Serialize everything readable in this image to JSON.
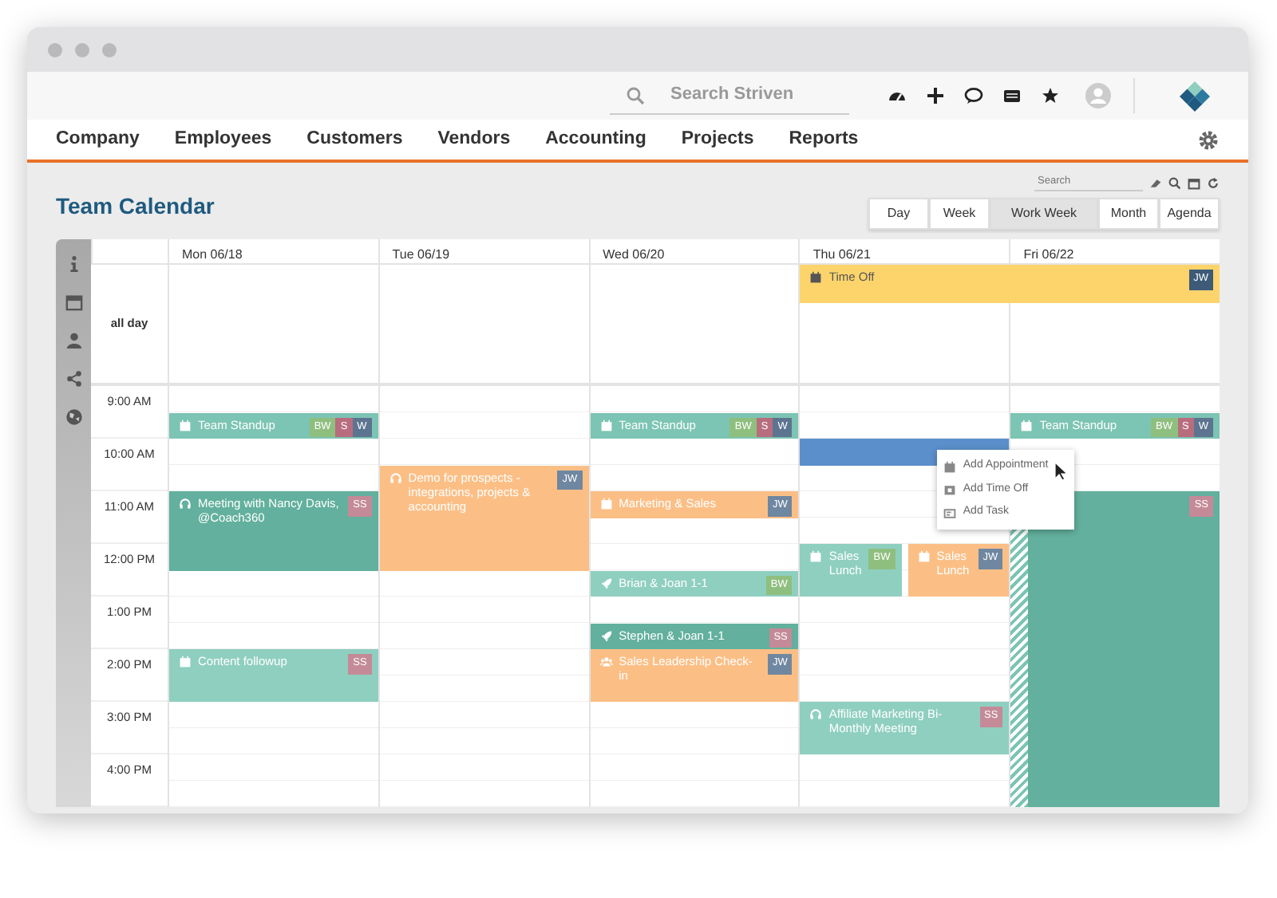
{
  "search": {
    "placeholder": "Search Striven"
  },
  "nav": [
    "Company",
    "Employees",
    "Customers",
    "Vendors",
    "Accounting",
    "Projects",
    "Reports"
  ],
  "page_title": "Team Calendar",
  "calendar_search": {
    "placeholder": "Search"
  },
  "views": [
    {
      "label": "Day",
      "selected": false
    },
    {
      "label": "Week",
      "selected": false
    },
    {
      "label": "Work Week",
      "selected": true
    },
    {
      "label": "Month",
      "selected": false
    },
    {
      "label": "Agenda",
      "selected": false
    }
  ],
  "all_day_label": "all day",
  "times": [
    "9:00 AM",
    "10:00 AM",
    "11:00 AM",
    "12:00 PM",
    "1:00 PM",
    "2:00 PM",
    "3:00 PM",
    "4:00 PM"
  ],
  "days": [
    {
      "label": "Mon 06/18",
      "events": [
        {
          "title": "Team Standup",
          "kind": "appointment",
          "color": "#7cc4b3",
          "badges": [
            {
              "text": "BW",
              "color": "#8fbf7f"
            },
            {
              "text": "S",
              "color": "#b86d7e"
            },
            {
              "text": "W",
              "color": "#5c7490"
            }
          ]
        },
        {
          "title": "Meeting with Nancy Davis, @Coach360",
          "kind": "call",
          "color": "#62b09d",
          "badges": [
            {
              "text": "SS",
              "color": "#c48a98"
            }
          ]
        },
        {
          "title": "Content followup",
          "kind": "appointment",
          "color": "#8fcfbf",
          "badges": [
            {
              "text": "SS",
              "color": "#c48a98"
            }
          ]
        }
      ]
    },
    {
      "label": "Tue 06/19",
      "events": [
        {
          "title": "Demo for prospects - integrations, projects & accounting",
          "kind": "call",
          "color": "#fbbf86",
          "badges": [
            {
              "text": "JW",
              "color": "#6f87a0"
            }
          ]
        }
      ]
    },
    {
      "label": "Wed 06/20",
      "events": [
        {
          "title": "Team Standup",
          "kind": "appointment",
          "color": "#7cc4b3",
          "badges": [
            {
              "text": "BW",
              "color": "#8fbf7f"
            },
            {
              "text": "S",
              "color": "#b86d7e"
            },
            {
              "text": "W",
              "color": "#5c7490"
            }
          ]
        },
        {
          "title": "Marketing & Sales",
          "kind": "appointment",
          "color": "#fbbf86",
          "badges": [
            {
              "text": "JW",
              "color": "#6f87a0"
            }
          ]
        },
        {
          "title": "Brian & Joan 1-1",
          "kind": "one-on-one",
          "color": "#8fcfbf",
          "badges": [
            {
              "text": "BW",
              "color": "#8fbf7f"
            }
          ]
        },
        {
          "title": "Stephen & Joan 1-1",
          "kind": "one-on-one",
          "color": "#62b09d",
          "badges": [
            {
              "text": "SS",
              "color": "#c48a98"
            }
          ]
        },
        {
          "title": "Sales Leadership Check-in",
          "kind": "group",
          "color": "#fbbf86",
          "badges": [
            {
              "text": "JW",
              "color": "#6f87a0"
            }
          ]
        }
      ]
    },
    {
      "label": "Thu 06/21",
      "all_day": [
        {
          "title": "Time Off",
          "color": "#fcd46b",
          "continues_next_day": true,
          "badges": [
            {
              "text": "JW",
              "color": "#3d5a78"
            }
          ]
        }
      ],
      "time_selection": true,
      "events": [
        {
          "title": "Sales Lunch",
          "kind": "appointment",
          "color": "#8fcfbf",
          "badges": [
            {
              "text": "BW",
              "color": "#8fbf7f"
            }
          ]
        },
        {
          "title": "Sales Lunch",
          "kind": "appointment",
          "color": "#fbbf86",
          "badges": [
            {
              "text": "JW",
              "color": "#6f87a0"
            }
          ]
        },
        {
          "title": "Affiliate Marketing Bi-Monthly Meeting",
          "kind": "call",
          "color": "#8fcfbf",
          "badges": [
            {
              "text": "SS",
              "color": "#c48a98"
            }
          ]
        }
      ]
    },
    {
      "label": "Fri 06/22",
      "events": [
        {
          "title": "Team Standup",
          "kind": "appointment",
          "color": "#7cc4b3",
          "badges": [
            {
              "text": "BW",
              "color": "#8fbf7f"
            },
            {
              "text": "S",
              "color": "#b86d7e"
            },
            {
              "text": "W",
              "color": "#5c7490"
            }
          ]
        },
        {
          "color": "#62b09d",
          "striped": true,
          "badges": [
            {
              "text": "SS",
              "color": "#c48a98"
            }
          ]
        }
      ]
    }
  ],
  "context_menu": [
    {
      "label": "Add Appointment",
      "kind": "appointment"
    },
    {
      "label": "Add Time Off",
      "kind": "time-off"
    },
    {
      "label": "Add Task",
      "kind": "task"
    }
  ]
}
